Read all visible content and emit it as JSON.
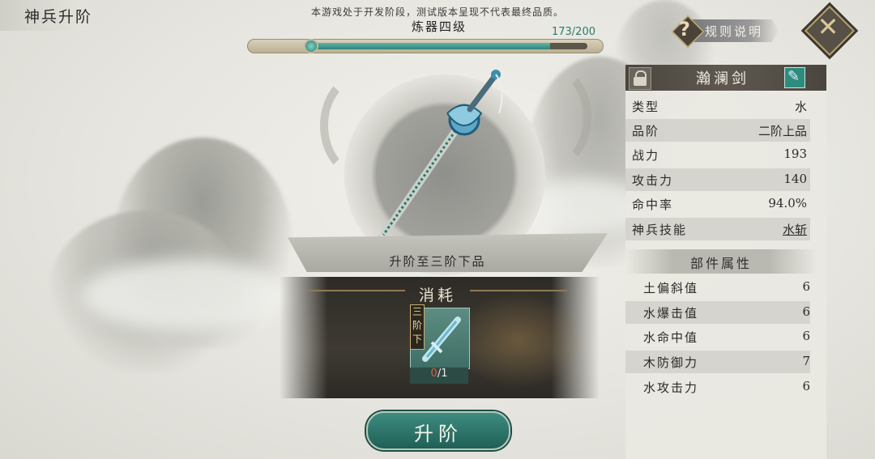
{
  "header": {
    "title": "神兵升阶",
    "notice": "本游戏处于开发阶段，测试版本呈现不代表最终品质。",
    "rules_label": "规则说明"
  },
  "refine": {
    "level_label": "炼器四级",
    "progress_text": "173/200",
    "progress_fraction": 0.865
  },
  "upgrade": {
    "target_text": "升阶至三阶下品",
    "consume_title": "消耗",
    "item_tag": "三阶下",
    "item_have": "0",
    "item_need": "/1",
    "button_label": "升阶"
  },
  "weapon": {
    "name": "瀚澜剑",
    "stats": [
      {
        "label": "类型",
        "value": "水"
      },
      {
        "label": "品阶",
        "value": "二阶上品"
      },
      {
        "label": "战力",
        "value": "193"
      },
      {
        "label": "攻击力",
        "value": "140"
      },
      {
        "label": "命中率",
        "value": "94.0%"
      },
      {
        "label": "神兵技能",
        "value": "水斩"
      }
    ],
    "parts_title": "部件属性",
    "parts": [
      {
        "label": "土偏斜值",
        "value": "6"
      },
      {
        "label": "水爆击值",
        "value": "6"
      },
      {
        "label": "水命中值",
        "value": "6"
      },
      {
        "label": "木防御力",
        "value": "7"
      },
      {
        "label": "水攻击力",
        "value": "6"
      }
    ]
  },
  "colors": {
    "accent": "#2f8478",
    "need_red": "#e05a4a"
  }
}
